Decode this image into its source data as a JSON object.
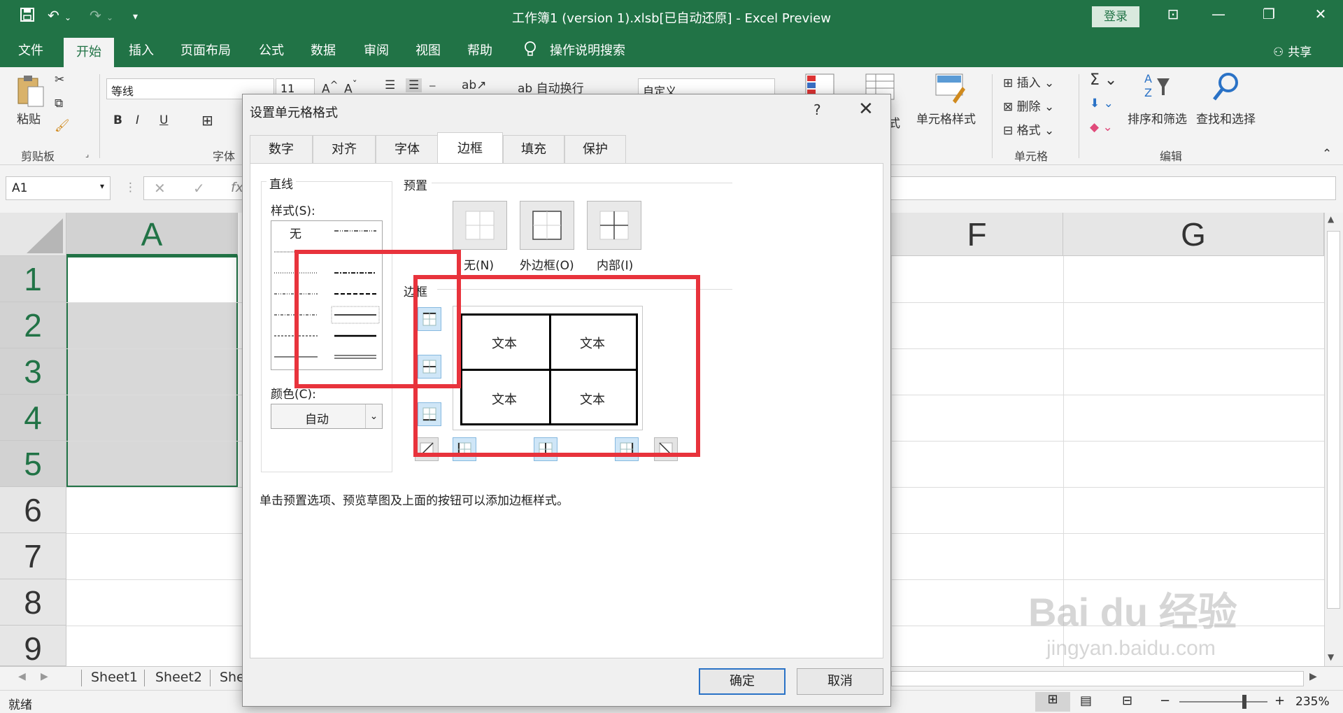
{
  "titlebar": {
    "title": "工作簿1 (version 1).xlsb[已自动还原]  -  Excel Preview",
    "login": "登录"
  },
  "menu": {
    "tabs": [
      "文件",
      "开始",
      "插入",
      "页面布局",
      "公式",
      "数据",
      "审阅",
      "视图",
      "帮助",
      "操作说明搜索"
    ],
    "share": "共享"
  },
  "ribbon": {
    "paste": "粘贴",
    "clipboard_label": "剪贴板",
    "font_name": "等线",
    "font_size": "11",
    "font_label": "字体",
    "bold": "B",
    "italic": "I",
    "underline": "U",
    "wrap_text": "自动换行",
    "number_format": "自定义",
    "cell_styles": "单元格样式",
    "cell_styles_partial": "式",
    "insert": "插入",
    "delete": "删除",
    "format": "格式",
    "cells_label": "单元格",
    "sort_filter": "排序和筛选",
    "find_select": "查找和选择",
    "edit_label": "编辑"
  },
  "formula_bar": {
    "name_box": "A1",
    "fx": "fx"
  },
  "grid": {
    "columns": [
      "A",
      "F",
      "G"
    ],
    "rows": [
      "1",
      "2",
      "3",
      "4",
      "5",
      "6",
      "7",
      "8",
      "9"
    ]
  },
  "sheets": [
    "Sheet1",
    "Sheet2",
    "She"
  ],
  "status": {
    "ready": "就绪",
    "zoom": "235%"
  },
  "dialog": {
    "title": "设置单元格格式",
    "help": "?",
    "tabs": [
      "数字",
      "对齐",
      "字体",
      "边框",
      "填充",
      "保护"
    ],
    "line_label": "直线",
    "style_label": "样式(S):",
    "style_none": "无",
    "color_label": "颜色(C):",
    "color_value": "自动",
    "preset_label": "预置",
    "preset_none": "无(N)",
    "preset_outline": "外边框(O)",
    "preset_inside": "内部(I)",
    "border_label": "边框",
    "preview_text": "文本",
    "hint": "单击预置选项、预览草图及上面的按钮可以添加边框样式。",
    "ok": "确定",
    "cancel": "取消"
  },
  "watermark": {
    "brand": "Bai du 经验",
    "url": "jingyan.baidu.com"
  },
  "colors": {
    "excel_green": "#217346",
    "highlight_red": "#e8333c"
  }
}
